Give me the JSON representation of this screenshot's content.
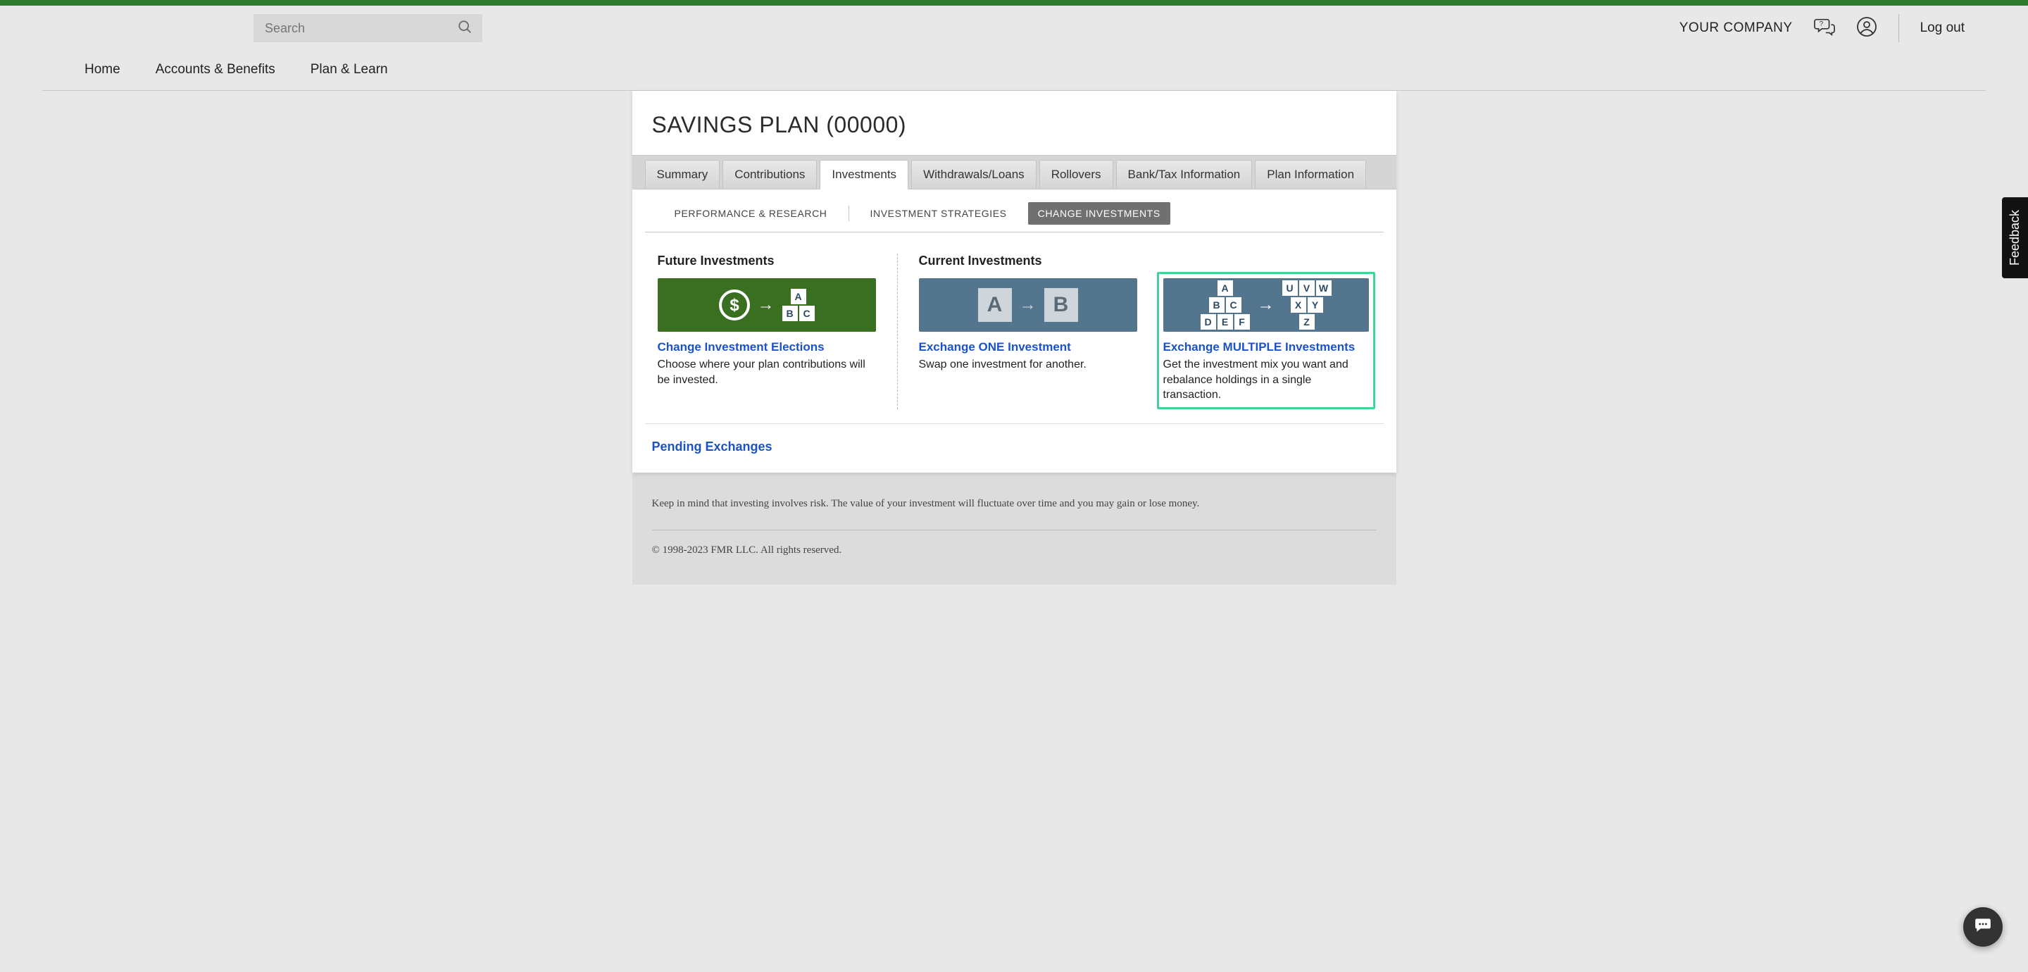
{
  "header": {
    "search_placeholder": "Search",
    "company_label": "YOUR COMPANY",
    "logout_label": "Log out"
  },
  "nav": {
    "home": "Home",
    "accounts": "Accounts & Benefits",
    "plan_learn": "Plan & Learn"
  },
  "page_title": "SAVINGS PLAN (00000)",
  "tabs": {
    "summary": "Summary",
    "contributions": "Contributions",
    "investments": "Investments",
    "withdrawals": "Withdrawals/Loans",
    "rollovers": "Rollovers",
    "banktax": "Bank/Tax Information",
    "planinfo": "Plan Information"
  },
  "subtabs": {
    "performance": "PERFORMANCE & RESEARCH",
    "strategies": "INVESTMENT STRATEGIES",
    "change": "CHANGE INVESTMENTS"
  },
  "future": {
    "heading": "Future Investments",
    "card1_title": "Change Investment Elections",
    "card1_desc": "Choose where your plan contributions will be invested."
  },
  "current": {
    "heading": "Current Investments",
    "card2_title": "Exchange ONE Investment",
    "card2_desc": "Swap one investment for another.",
    "card3_title": "Exchange MULTIPLE Investments",
    "card3_desc": "Get the investment mix you want and rebalance holdings in a single transaction."
  },
  "pending_link": "Pending Exchanges",
  "footer": {
    "disclaimer": "Keep in mind that investing involves risk. The value of your investment will fluctuate over time and you may gain or lose money.",
    "copyright": "© 1998-2023 FMR LLC.  All rights reserved."
  },
  "feedback_label": "Feedback"
}
